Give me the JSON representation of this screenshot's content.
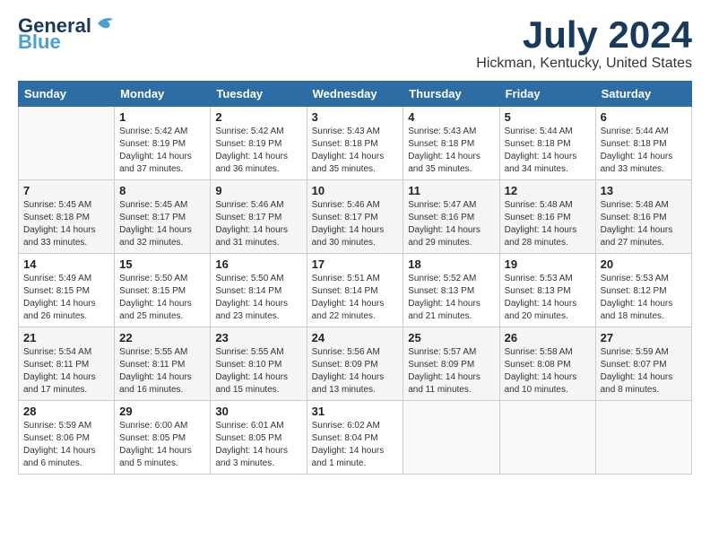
{
  "app": {
    "logo_line1": "General",
    "logo_line2": "Blue",
    "month_title": "July 2024",
    "location": "Hickman, Kentucky, United States"
  },
  "calendar": {
    "headers": [
      "Sunday",
      "Monday",
      "Tuesday",
      "Wednesday",
      "Thursday",
      "Friday",
      "Saturday"
    ],
    "weeks": [
      [
        {
          "day": "",
          "info": ""
        },
        {
          "day": "1",
          "info": "Sunrise: 5:42 AM\nSunset: 8:19 PM\nDaylight: 14 hours\nand 37 minutes."
        },
        {
          "day": "2",
          "info": "Sunrise: 5:42 AM\nSunset: 8:19 PM\nDaylight: 14 hours\nand 36 minutes."
        },
        {
          "day": "3",
          "info": "Sunrise: 5:43 AM\nSunset: 8:18 PM\nDaylight: 14 hours\nand 35 minutes."
        },
        {
          "day": "4",
          "info": "Sunrise: 5:43 AM\nSunset: 8:18 PM\nDaylight: 14 hours\nand 35 minutes."
        },
        {
          "day": "5",
          "info": "Sunrise: 5:44 AM\nSunset: 8:18 PM\nDaylight: 14 hours\nand 34 minutes."
        },
        {
          "day": "6",
          "info": "Sunrise: 5:44 AM\nSunset: 8:18 PM\nDaylight: 14 hours\nand 33 minutes."
        }
      ],
      [
        {
          "day": "7",
          "info": "Sunrise: 5:45 AM\nSunset: 8:18 PM\nDaylight: 14 hours\nand 33 minutes."
        },
        {
          "day": "8",
          "info": "Sunrise: 5:45 AM\nSunset: 8:17 PM\nDaylight: 14 hours\nand 32 minutes."
        },
        {
          "day": "9",
          "info": "Sunrise: 5:46 AM\nSunset: 8:17 PM\nDaylight: 14 hours\nand 31 minutes."
        },
        {
          "day": "10",
          "info": "Sunrise: 5:46 AM\nSunset: 8:17 PM\nDaylight: 14 hours\nand 30 minutes."
        },
        {
          "day": "11",
          "info": "Sunrise: 5:47 AM\nSunset: 8:16 PM\nDaylight: 14 hours\nand 29 minutes."
        },
        {
          "day": "12",
          "info": "Sunrise: 5:48 AM\nSunset: 8:16 PM\nDaylight: 14 hours\nand 28 minutes."
        },
        {
          "day": "13",
          "info": "Sunrise: 5:48 AM\nSunset: 8:16 PM\nDaylight: 14 hours\nand 27 minutes."
        }
      ],
      [
        {
          "day": "14",
          "info": "Sunrise: 5:49 AM\nSunset: 8:15 PM\nDaylight: 14 hours\nand 26 minutes."
        },
        {
          "day": "15",
          "info": "Sunrise: 5:50 AM\nSunset: 8:15 PM\nDaylight: 14 hours\nand 25 minutes."
        },
        {
          "day": "16",
          "info": "Sunrise: 5:50 AM\nSunset: 8:14 PM\nDaylight: 14 hours\nand 23 minutes."
        },
        {
          "day": "17",
          "info": "Sunrise: 5:51 AM\nSunset: 8:14 PM\nDaylight: 14 hours\nand 22 minutes."
        },
        {
          "day": "18",
          "info": "Sunrise: 5:52 AM\nSunset: 8:13 PM\nDaylight: 14 hours\nand 21 minutes."
        },
        {
          "day": "19",
          "info": "Sunrise: 5:53 AM\nSunset: 8:13 PM\nDaylight: 14 hours\nand 20 minutes."
        },
        {
          "day": "20",
          "info": "Sunrise: 5:53 AM\nSunset: 8:12 PM\nDaylight: 14 hours\nand 18 minutes."
        }
      ],
      [
        {
          "day": "21",
          "info": "Sunrise: 5:54 AM\nSunset: 8:11 PM\nDaylight: 14 hours\nand 17 minutes."
        },
        {
          "day": "22",
          "info": "Sunrise: 5:55 AM\nSunset: 8:11 PM\nDaylight: 14 hours\nand 16 minutes."
        },
        {
          "day": "23",
          "info": "Sunrise: 5:55 AM\nSunset: 8:10 PM\nDaylight: 14 hours\nand 15 minutes."
        },
        {
          "day": "24",
          "info": "Sunrise: 5:56 AM\nSunset: 8:09 PM\nDaylight: 14 hours\nand 13 minutes."
        },
        {
          "day": "25",
          "info": "Sunrise: 5:57 AM\nSunset: 8:09 PM\nDaylight: 14 hours\nand 11 minutes."
        },
        {
          "day": "26",
          "info": "Sunrise: 5:58 AM\nSunset: 8:08 PM\nDaylight: 14 hours\nand 10 minutes."
        },
        {
          "day": "27",
          "info": "Sunrise: 5:59 AM\nSunset: 8:07 PM\nDaylight: 14 hours\nand 8 minutes."
        }
      ],
      [
        {
          "day": "28",
          "info": "Sunrise: 5:59 AM\nSunset: 8:06 PM\nDaylight: 14 hours\nand 6 minutes."
        },
        {
          "day": "29",
          "info": "Sunrise: 6:00 AM\nSunset: 8:05 PM\nDaylight: 14 hours\nand 5 minutes."
        },
        {
          "day": "30",
          "info": "Sunrise: 6:01 AM\nSunset: 8:05 PM\nDaylight: 14 hours\nand 3 minutes."
        },
        {
          "day": "31",
          "info": "Sunrise: 6:02 AM\nSunset: 8:04 PM\nDaylight: 14 hours\nand 1 minute."
        },
        {
          "day": "",
          "info": ""
        },
        {
          "day": "",
          "info": ""
        },
        {
          "day": "",
          "info": ""
        }
      ]
    ]
  }
}
